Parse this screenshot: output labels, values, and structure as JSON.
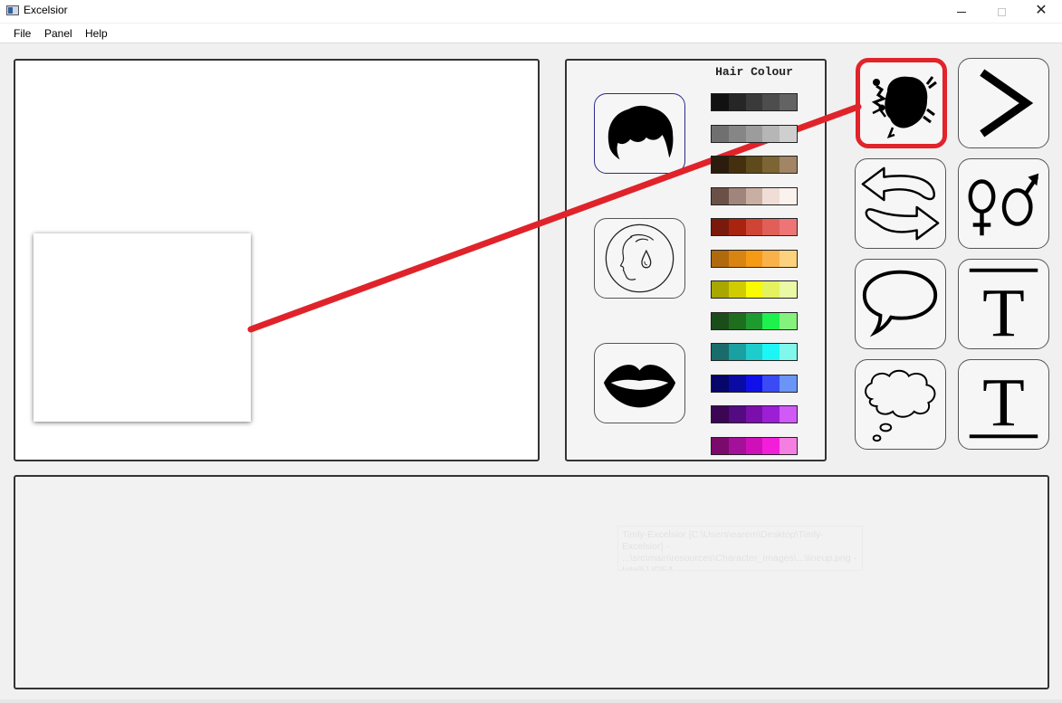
{
  "window": {
    "title": "Excelsior",
    "minimize": "–",
    "maximize": "□",
    "close": "✕"
  },
  "menu": [
    "File",
    "Panel",
    "Help"
  ],
  "attributes_panel": {
    "title": "Hair Colour",
    "buttons": [
      {
        "name": "hair-icon",
        "selected": true
      },
      {
        "name": "skin-tone-icon",
        "selected": false
      },
      {
        "name": "lips-icon",
        "selected": false
      }
    ],
    "palette_rows": [
      [
        "#111111",
        "#262626",
        "#3a3a3a",
        "#4d4d4d",
        "#636363"
      ],
      [
        "#707070",
        "#868686",
        "#9c9c9c",
        "#b6b6b6",
        "#cfcfcf"
      ],
      [
        "#2b1d0e",
        "#44300f",
        "#5f4a1c",
        "#7d6434",
        "#a18565"
      ],
      [
        "#6b5047",
        "#a0857c",
        "#c9aea2",
        "#f0ded6",
        "#fbf2ee"
      ],
      [
        "#7a1a0c",
        "#a8240f",
        "#cf4435",
        "#e05f59",
        "#ee7575"
      ],
      [
        "#b0690d",
        "#d98412",
        "#f59a15",
        "#fbb14a",
        "#fdd27f"
      ],
      [
        "#a9a600",
        "#d0cc00",
        "#fafa00",
        "#e4f25d",
        "#eaf9a6"
      ],
      [
        "#1b4d1b",
        "#1f6e1f",
        "#1f9a2e",
        "#1ef04d",
        "#84f27d"
      ],
      [
        "#1a6b6b",
        "#1aa0a0",
        "#1ecccc",
        "#1ef5f5",
        "#7ff7ea"
      ],
      [
        "#06066b",
        "#0a0aa5",
        "#1010e8",
        "#3a4af5",
        "#6a94f7"
      ],
      [
        "#3b0654",
        "#540a80",
        "#7a0fab",
        "#9c1ed6",
        "#cf5af5"
      ],
      [
        "#7a0a6b",
        "#a5109a",
        "#cf10b8",
        "#f21ed9",
        "#f57fe0"
      ]
    ]
  },
  "tools": [
    {
      "name": "character-icon",
      "highlighted": true
    },
    {
      "name": "next-arrow-icon"
    },
    {
      "name": "swap-arrows-icon"
    },
    {
      "name": "gender-icon"
    },
    {
      "name": "speech-bubble-icon"
    },
    {
      "name": "overline-text-icon"
    },
    {
      "name": "thought-bubble-icon"
    },
    {
      "name": "underline-text-icon"
    }
  ],
  "dialogue_panel": {
    "ghost_text": "Timly-Excelsior [C:\\Users\\earem\\Desktop\\Timly-Excelsior] - ...\\src\\main\\resources\\Character_Images\\...\\lineup.png - IntelliJ IDEA"
  },
  "colors": {
    "highlight": "#e1232a",
    "annotation": "#e0232a"
  }
}
